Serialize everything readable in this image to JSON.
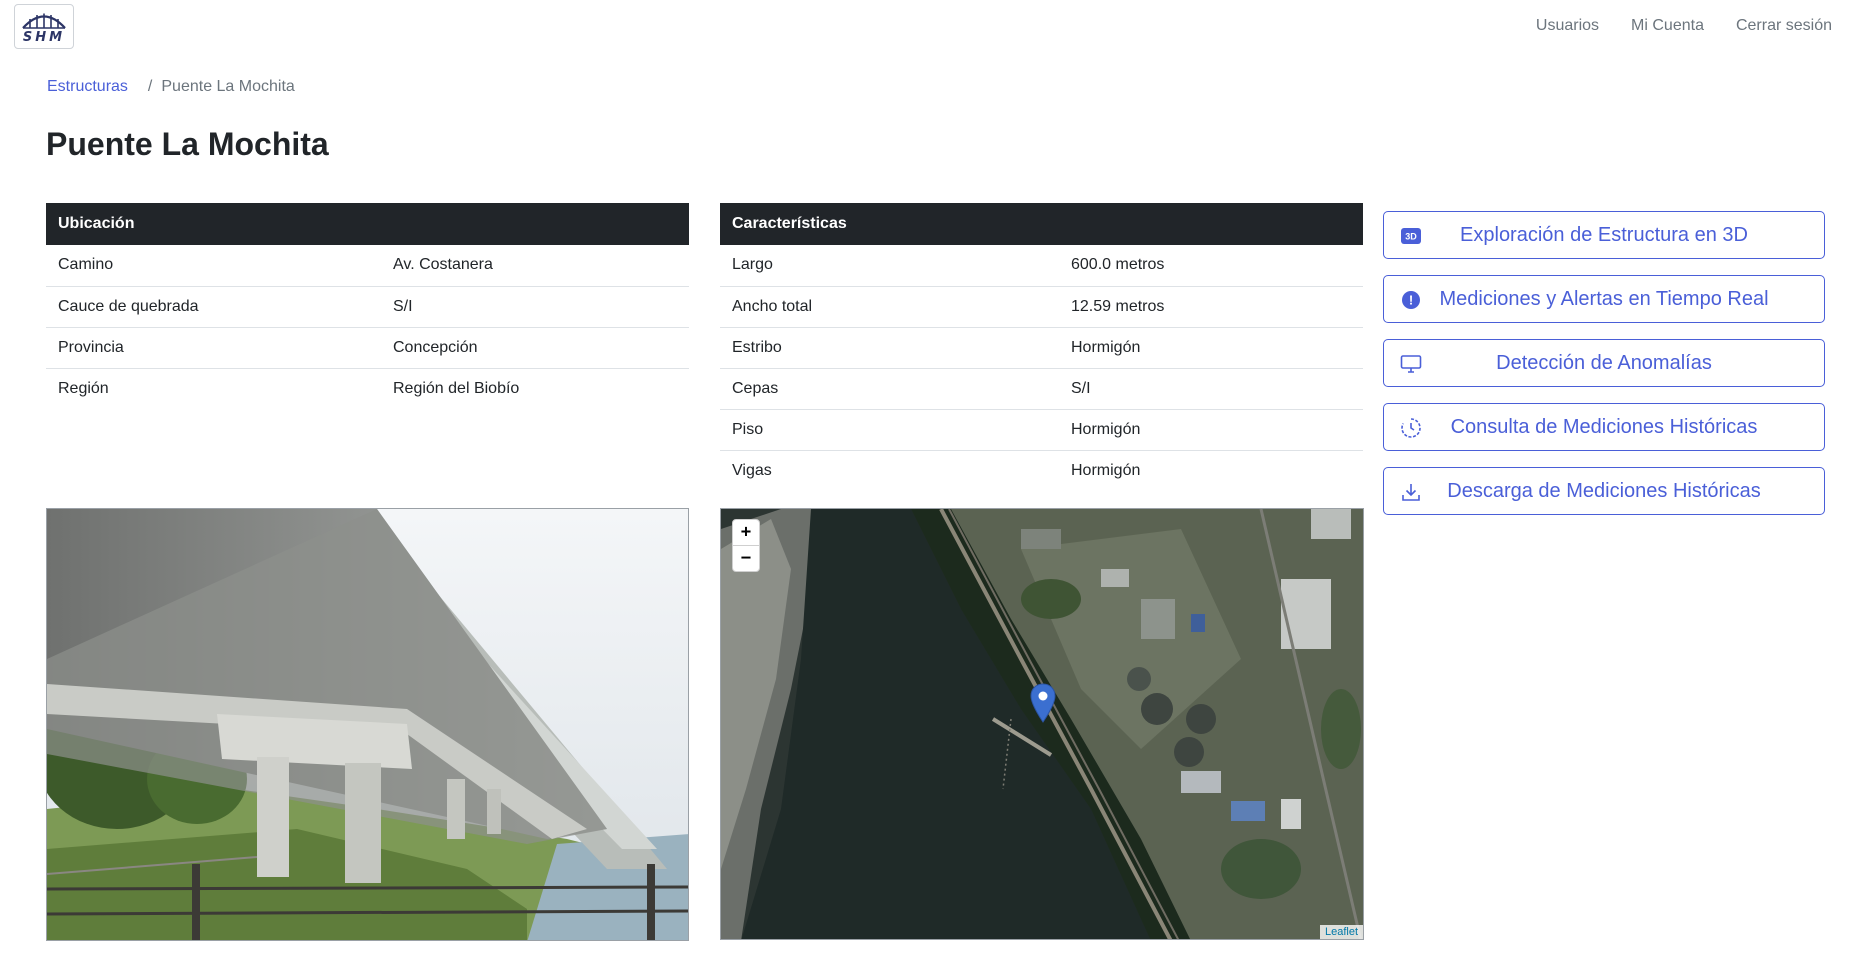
{
  "brand": {
    "logo_text": "SHM"
  },
  "nav": {
    "items": [
      "Usuarios",
      "Mi Cuenta",
      "Cerrar sesión"
    ]
  },
  "breadcrumb": {
    "parent": "Estructuras",
    "separator": "/",
    "current": "Puente La Mochita"
  },
  "page": {
    "title": "Puente La Mochita"
  },
  "location_table": {
    "header": "Ubicación",
    "rows": [
      {
        "label": "Camino",
        "value": "Av. Costanera"
      },
      {
        "label": "Cauce de quebrada",
        "value": "S/I"
      },
      {
        "label": "Provincia",
        "value": "Concepción"
      },
      {
        "label": "Región",
        "value": "Región del Biobío"
      }
    ]
  },
  "features_table": {
    "header": "Características",
    "rows": [
      {
        "label": "Largo",
        "value": "600.0 metros"
      },
      {
        "label": "Ancho total",
        "value": "12.59 metros"
      },
      {
        "label": "Estribo",
        "value": "Hormigón"
      },
      {
        "label": "Cepas",
        "value": "S/I"
      },
      {
        "label": "Piso",
        "value": "Hormigón"
      },
      {
        "label": "Vigas",
        "value": "Hormigón"
      }
    ]
  },
  "actions": [
    {
      "label": "Exploración de Estructura en 3D",
      "icon": "3d-icon",
      "icon_text": "3D"
    },
    {
      "label": "Mediciones y Alertas en Tiempo Real",
      "icon": "alert-icon",
      "icon_text": "!"
    },
    {
      "label": "Detección de Anomalías",
      "icon": "monitor-icon"
    },
    {
      "label": "Consulta de Mediciones Históricas",
      "icon": "history-icon"
    },
    {
      "label": "Descarga de Mediciones Históricas",
      "icon": "download-icon"
    }
  ],
  "map": {
    "zoom_in": "+",
    "zoom_out": "−",
    "attribution": "Leaflet"
  },
  "colors": {
    "primary": "#4a5fd8",
    "table_header": "#212529",
    "muted": "#6c757d",
    "marker": "#3b6fd0"
  }
}
